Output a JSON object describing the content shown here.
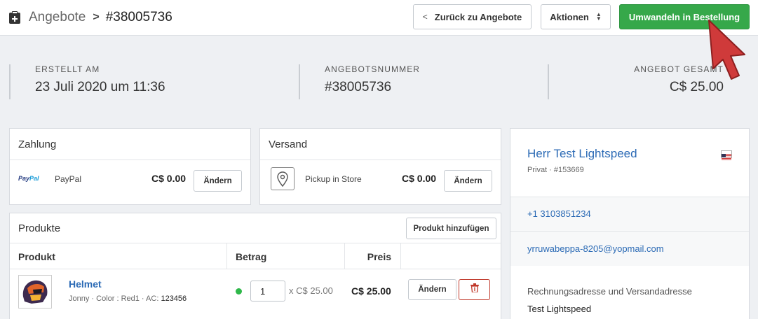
{
  "header": {
    "breadcrumb_parent": "Angebote",
    "breadcrumb_current": "#38005736",
    "back_label": "Zurück zu Angebote",
    "actions_label": "Aktionen",
    "convert_label": "Umwandeln in Bestellung",
    "convert_color": "#36a84a"
  },
  "summary": {
    "created_label": "ERSTELLT AM",
    "created_value": "23 Juli 2020 um 11:36",
    "number_label": "ANGEBOTSNUMMER",
    "number_value": "#38005736",
    "total_label": "ANGEBOT GESAMT",
    "total_value": "C$ 25.00"
  },
  "payment": {
    "title": "Zahlung",
    "logo": "PayPal",
    "method": "PayPal",
    "amount": "C$ 0.00",
    "change_label": "Ändern"
  },
  "shipping": {
    "title": "Versand",
    "icon": "map-pin-icon",
    "method": "Pickup in Store",
    "amount": "C$ 0.00",
    "change_label": "Ändern"
  },
  "products": {
    "title": "Produkte",
    "add_label": "Produkt hinzufügen",
    "columns": [
      "Produkt",
      "Betrag",
      "Preis"
    ],
    "items": [
      {
        "name": "Helmet",
        "meta": "Jonny · Color : Red1 · AC:",
        "code": "123456",
        "quantity": "1",
        "unit_price": "x C$ 25.00",
        "price": "C$ 25.00",
        "change_label": "Ändern",
        "status_color": "#2fb84a"
      }
    ]
  },
  "customer": {
    "name": "Herr Test Lightspeed",
    "type": "Privat · #153669",
    "flag": "us-flag-icon",
    "phone": "+1 3103851234",
    "email": "yrruwabeppa-8205@yopmail.com",
    "address_label": "Rechnungsadresse und Versandadresse",
    "address_name": "Test Lightspeed"
  }
}
